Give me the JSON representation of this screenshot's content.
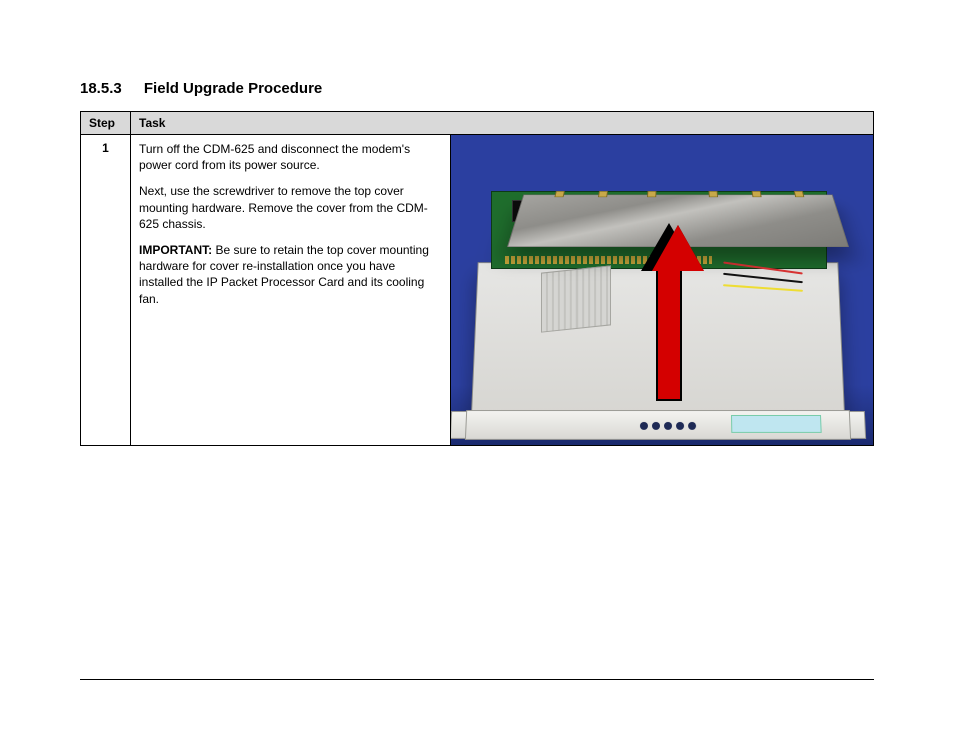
{
  "heading": {
    "number": "18.5.3",
    "title": "Field Upgrade Procedure"
  },
  "table": {
    "headers": {
      "step": "Step",
      "task": "Task"
    },
    "rows": [
      {
        "step": "1",
        "task": {
          "p1": "Turn off the CDM-625 and disconnect the modem's power cord from its power source.",
          "p2": "Next, use the screwdriver to remove the top cover mounting hardware. Remove the cover from the CDM-625 chassis.",
          "imp_label": "IMPORTANT:",
          "imp_text": " Be sure to retain the top cover mounting hardware for cover re-installation once you have installed the IP Packet Processor Card and its cooling fan."
        }
      }
    ]
  }
}
